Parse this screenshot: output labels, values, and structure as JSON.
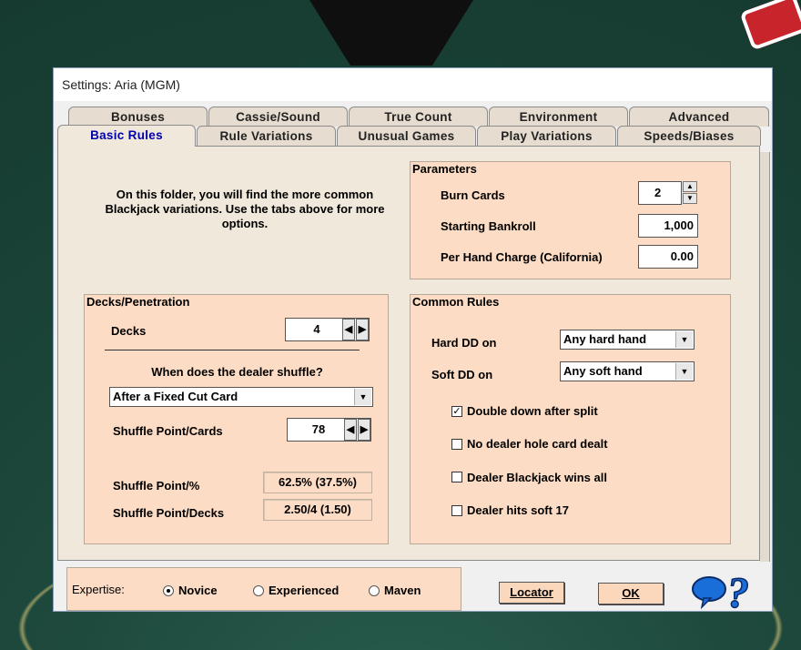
{
  "window": {
    "title": "Settings: Aria (MGM)"
  },
  "tabs": {
    "row1": [
      "Bonuses",
      "Cassie/Sound",
      "True Count",
      "Environment",
      "Advanced"
    ],
    "row2": [
      "Basic Rules",
      "Rule Variations",
      "Unusual Games",
      "Play Variations",
      "Speeds/Biases"
    ],
    "active": "Basic Rules"
  },
  "intro": "On this folder, you will find the more common Blackjack variations.  Use the tabs above for more options.",
  "parameters": {
    "title": "Parameters",
    "burn_cards_label": "Burn Cards",
    "burn_cards_value": "2",
    "bankroll_label": "Starting Bankroll",
    "bankroll_value": "1,000",
    "per_hand_label": "Per Hand Charge (California)",
    "per_hand_value": "0.00"
  },
  "decks": {
    "title": "Decks/Penetration",
    "decks_label": "Decks",
    "decks_value": "4",
    "shuffle_question": "When does the dealer shuffle?",
    "shuffle_method": "After a Fixed Cut Card",
    "shuffle_point_cards_label": "Shuffle Point/Cards",
    "shuffle_point_cards_value": "78",
    "shuffle_point_pct_label": "Shuffle Point/%",
    "shuffle_point_pct_value": "62.5% (37.5%)",
    "shuffle_point_decks_label": "Shuffle Point/Decks",
    "shuffle_point_decks_value": "2.50/4 (1.50)"
  },
  "common_rules": {
    "title": "Common Rules",
    "hard_dd_label": "Hard DD on",
    "hard_dd_value": "Any hard hand",
    "soft_dd_label": "Soft DD on",
    "soft_dd_value": "Any soft hand",
    "checks": [
      {
        "label": "Double down after split",
        "checked": true
      },
      {
        "label": "No dealer hole card dealt",
        "checked": false
      },
      {
        "label": "Dealer Blackjack wins all",
        "checked": false
      },
      {
        "label": "Dealer hits soft 17",
        "checked": false
      }
    ]
  },
  "expertise": {
    "label": "Expertise:",
    "options": [
      "Novice",
      "Experienced",
      "Maven"
    ],
    "selected": "Novice"
  },
  "buttons": {
    "locator": "Locator",
    "ok": "OK"
  },
  "icons": {
    "help": "help-question-icon",
    "balloon": "speech-balloon-icon",
    "spin_up": "spin-up-icon",
    "spin_down": "spin-down-icon"
  },
  "colors": {
    "panel": "#fcdcc4",
    "active_tab_text": "#0000aa",
    "felt": "#1e4a3d"
  }
}
